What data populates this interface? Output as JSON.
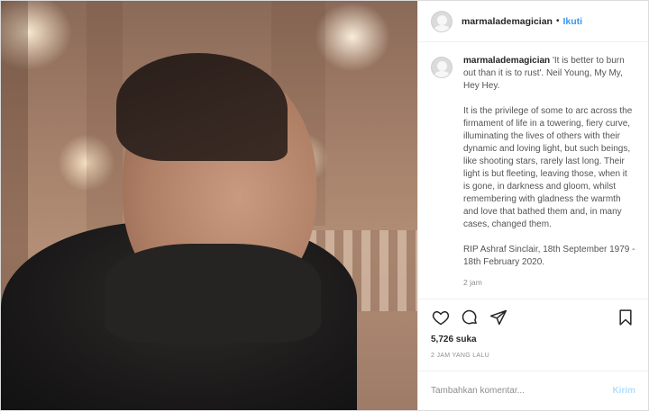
{
  "post": {
    "username": "marmalademagician",
    "separator": "•",
    "follow_label": "Ikuti"
  },
  "caption": {
    "username": "marmalademagician",
    "line1": " 'It is better to burn out than it is to rust'. Neil Young, My My, Hey Hey.",
    "paragraph2": "It is the privilege of some to arc across the firmament of life in a towering, fiery curve, illuminating the lives of others with their dynamic and loving light, but such beings, like shooting stars, rarely last long. Their light is but fleeting, leaving those, when it is gone, in darkness and gloom, whilst remembering with gladness the warmth and love that bathed them and, in many cases, changed them.",
    "paragraph3": "RIP Ashraf Sinclair, 18th September 1979 - 18th February 2020.",
    "time": "2 jam"
  },
  "icons": {
    "like": "heart-icon",
    "comment": "comment-icon",
    "share": "share-icon",
    "save": "bookmark-icon"
  },
  "likes_text": "5,726 suka",
  "posted_ago": "2 JAM YANG LALU",
  "comment_box": {
    "placeholder": "Tambahkan komentar...",
    "send_label": "Kirim"
  },
  "colors": {
    "accent": "#3897f0",
    "send_disabled": "#b2dffc"
  }
}
